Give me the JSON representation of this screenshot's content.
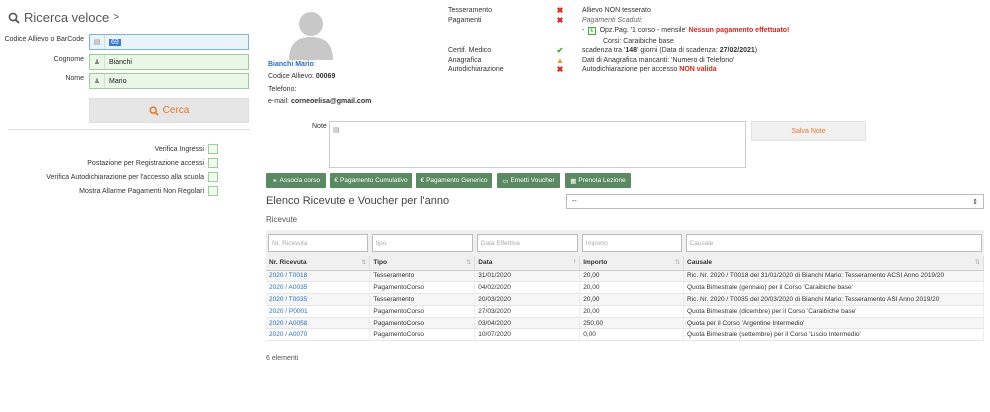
{
  "search": {
    "title": "Ricerca veloce",
    "chevron": ">",
    "fields": [
      {
        "label": "Codice Allievo o BarCode",
        "value": "69",
        "icon": "barcode-icon"
      },
      {
        "label": "Cognome",
        "value": "Bianchi",
        "icon": "user-icon"
      },
      {
        "label": "Nome",
        "value": "Mario",
        "icon": "user-icon"
      }
    ],
    "button": "Cerca",
    "checks": [
      "Verifica Ingressi",
      "Postazione per Registrazione accessi",
      "Verifica Autodichiarazione per l'accesso alla scuola",
      "Mostra Allarme Pagamenti Non Regolari"
    ]
  },
  "profile": {
    "name": "Bianchi Mario",
    "code_label": "Codice Allievo:",
    "code": "00069",
    "phone_label": "Telefono:",
    "email_label": "e-mail:",
    "email": "corneoelisa@gmail.com"
  },
  "status": {
    "tesseramento": {
      "label": "Tesseramento",
      "text": "Allievo NON tesserato"
    },
    "pagamenti": {
      "label": "Pagamenti",
      "scaduti": "Pagamenti Scaduti:",
      "opz_prefix": "-",
      "opz": "Opz.Pag. '1 corso - mensile'",
      "opz_alert": "Nessun pagamento effettuato!",
      "corsi": "Corsi: Caraibiche base"
    },
    "certif": {
      "label": "Certif. Medico",
      "pre": "scadenza tra '",
      "days": "148",
      "mid": "' giorni (Data di scadenza: ",
      "date": "27/02/2021",
      "post": ")"
    },
    "anagrafica": {
      "label": "Anagrafica",
      "text": "Dati di Anagrafica mancanti: 'Numero di Telefono'"
    },
    "autodich": {
      "label": "Autodichiarazione",
      "text": "Autodichiarazione per accesso",
      "alert": "NON valida"
    }
  },
  "notes": {
    "label": "Note",
    "button": "Salva Note"
  },
  "actions": [
    "Associa corso",
    "Pagamento Cumulativo",
    "Pagamento Generico",
    "Emetti Voucher",
    "Prenota Lezione"
  ],
  "receipts": {
    "heading": "Elenco Ricevute e Voucher per l'anno",
    "year_select": "--",
    "subheading": "Ricevute",
    "filters": [
      "Nr. Ricevuta",
      "tipo",
      "Data Effettiva",
      "Importo",
      "Causale"
    ],
    "columns": [
      "Nr. Ricevuta",
      "Tipo",
      "Data",
      "Importo",
      "Causale"
    ],
    "rows": [
      [
        "2020 / T0018",
        "Tesseramento",
        "31/01/2020",
        "20,00",
        "Ric. Nr. 2020 / T0018 del 31/01/2020 di Bianchi Mario: Tesseramento ACSI Anno 2019/20"
      ],
      [
        "2020 / A0035",
        "PagamentoCorso",
        "04/02/2020",
        "20,00",
        "Quota Bimestrale (gennaio) per il Corso 'Caraibiche base'"
      ],
      [
        "2020 / T0035",
        "Tesseramento",
        "20/03/2020",
        "20,00",
        "Ric. Nr. 2020 / T0035 del 20/03/2020 di Bianchi Mario: Tesseramento ASI Anno 2019/20"
      ],
      [
        "2020 / P0001",
        "PagamentoCorso",
        "27/03/2020",
        "20,00",
        "Quota Bimestrale (dicembre) per il Corso 'Caraibiche base'"
      ],
      [
        "2020 / A0058",
        "PagamentoCorso",
        "03/04/2020",
        "250,00",
        "Quota per il Corso 'Argentine Intermedio'"
      ],
      [
        "2020 / A0070",
        "PagamentoCorso",
        "10/07/2020",
        "0,00",
        "Quota Bimestrale (settembre) per il Corso 'Liscio Intermedio'"
      ]
    ],
    "count": "6 elementi"
  },
  "colors": {
    "accent": "#e8762c",
    "action_green": "#5b8a62",
    "link": "#2a6ebb",
    "alert_red": "#d9251c"
  }
}
